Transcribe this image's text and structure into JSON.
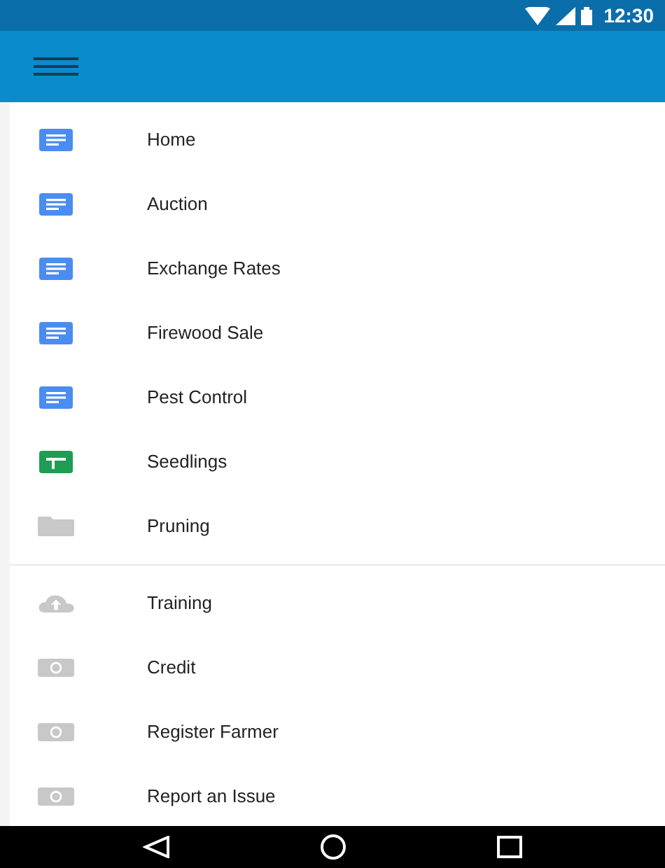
{
  "status_bar": {
    "time": "12:30"
  },
  "menu_sections": [
    {
      "items": [
        {
          "label": "Home",
          "kind": "doc"
        },
        {
          "label": "Auction",
          "kind": "doc"
        },
        {
          "label": "Exchange Rates",
          "kind": "doc"
        },
        {
          "label": "Firewood Sale",
          "kind": "doc"
        },
        {
          "label": "Pest Control",
          "kind": "doc"
        },
        {
          "label": "Seedlings",
          "kind": "sheet"
        },
        {
          "label": "Pruning",
          "kind": "folder"
        }
      ]
    },
    {
      "items": [
        {
          "label": "Training",
          "kind": "cloud"
        },
        {
          "label": "Credit",
          "kind": "camera"
        },
        {
          "label": "Register Farmer",
          "kind": "camera"
        },
        {
          "label": "Report an Issue",
          "kind": "camera"
        }
      ]
    }
  ]
}
